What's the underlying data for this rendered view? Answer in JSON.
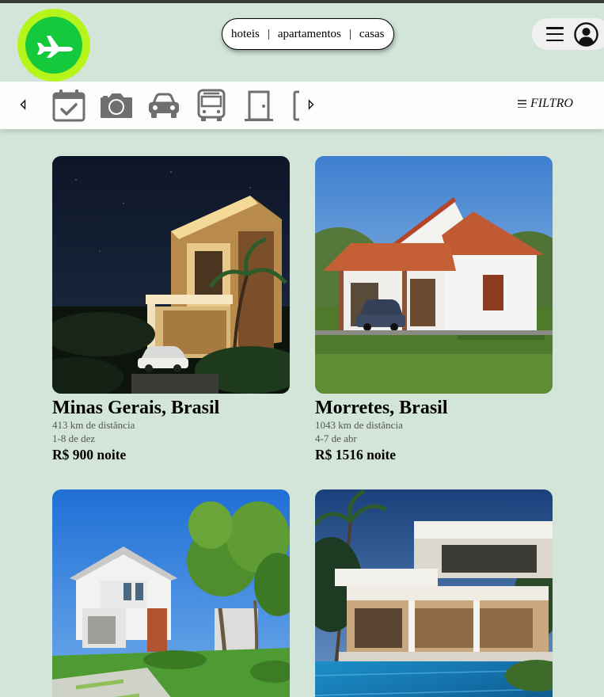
{
  "header": {
    "logo_icon": "airplane-icon",
    "nav": {
      "hotels": "hoteis",
      "apartments": "apartamentos",
      "houses": "casas",
      "separator": "|"
    },
    "menu_icon": "hamburger-icon",
    "user_icon": "user-icon"
  },
  "categories": {
    "prev_icon": "arrow-left-icon",
    "next_icon": "arrow-right-icon",
    "items": [
      "calendar-check-icon",
      "camera-icon",
      "car-icon",
      "bus-icon",
      "door-icon",
      "partial-icon"
    ],
    "filter_label": "FILTRO"
  },
  "listings": [
    {
      "title": "Minas Gerais, Brasil",
      "distance": "413 km de distância",
      "dates": "1-8 de dez",
      "price": "R$ 900 noite"
    },
    {
      "title": "Morretes, Brasil",
      "distance": "1043 km de distância",
      "dates": "4-7 de abr",
      "price": "R$ 1516 noite"
    },
    {
      "title": "",
      "distance": "",
      "dates": "",
      "price": ""
    },
    {
      "title": "",
      "distance": "",
      "dates": "",
      "price": ""
    }
  ],
  "colors": {
    "background": "#d3e5d9",
    "logo_outer": "#b6f51c",
    "logo_inner": "#14c93b",
    "icon_gray": "#6f6f6f"
  }
}
